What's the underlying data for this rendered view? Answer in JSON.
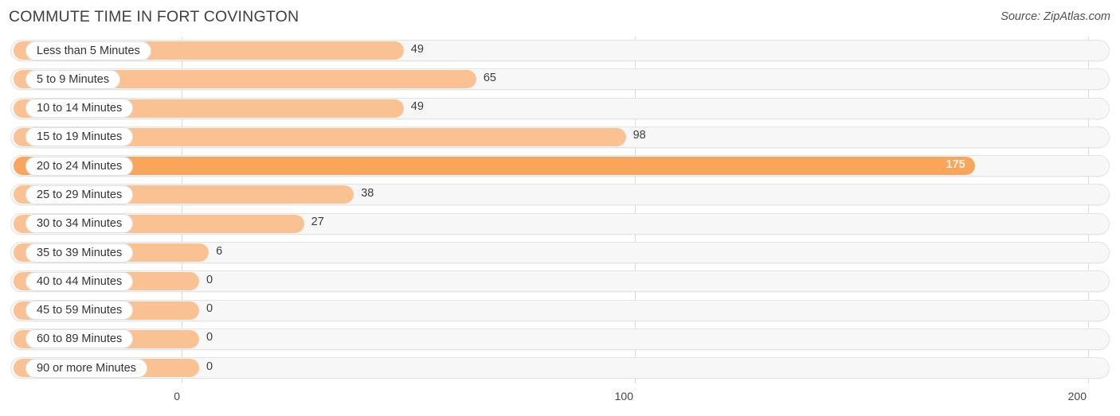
{
  "header": {
    "title": "COMMUTE TIME IN FORT COVINGTON",
    "source": "Source: ZipAtlas.com"
  },
  "colors": {
    "bar": "#fac292",
    "bar_highlight": "#f9a55c",
    "track": "#f7f7f7",
    "track_border": "#e3e3e3",
    "gridline": "#dcdcdc",
    "label_text": "#333333",
    "value_text": "#3c3c3c",
    "value_text_inside": "#fdf4e8"
  },
  "chart_data": {
    "type": "bar",
    "orientation": "horizontal",
    "title": "COMMUTE TIME IN FORT COVINGTON",
    "xlabel": "",
    "ylabel": "",
    "xlim": [
      0,
      200
    ],
    "xticks": [
      0,
      100,
      200
    ],
    "xticklabels": [
      "0",
      "100",
      "200"
    ],
    "grid": true,
    "legend": false,
    "highlight_category": "20 to 24 Minutes",
    "categories": [
      "Less than 5 Minutes",
      "5 to 9 Minutes",
      "10 to 14 Minutes",
      "15 to 19 Minutes",
      "20 to 24 Minutes",
      "25 to 29 Minutes",
      "30 to 34 Minutes",
      "35 to 39 Minutes",
      "40 to 44 Minutes",
      "45 to 59 Minutes",
      "60 to 89 Minutes",
      "90 or more Minutes"
    ],
    "values": [
      49,
      65,
      49,
      98,
      175,
      38,
      27,
      6,
      0,
      0,
      0,
      0
    ],
    "value_labels": [
      "49",
      "65",
      "49",
      "98",
      "175",
      "38",
      "27",
      "6",
      "0",
      "0",
      "0",
      "0"
    ]
  }
}
